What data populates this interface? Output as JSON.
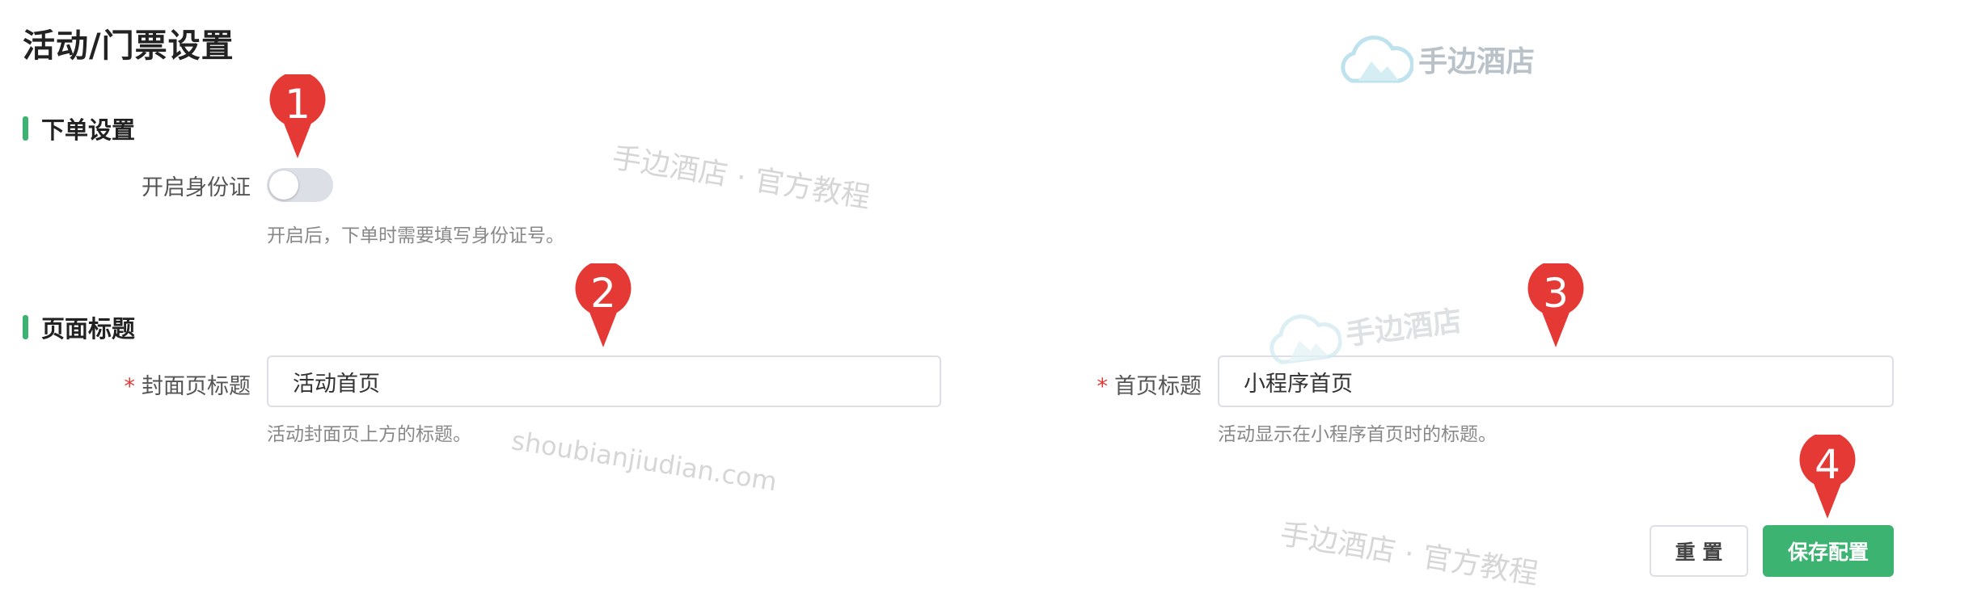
{
  "page": {
    "title": "活动/门票设置"
  },
  "order_section": {
    "heading": "下单设置",
    "id_verify": {
      "label": "开启身份证",
      "enabled": false,
      "hint": "开启后，下单时需要填写身份证号。"
    }
  },
  "title_section": {
    "heading": "页面标题",
    "cover_title": {
      "required_mark": "*",
      "label": "封面页标题",
      "value": "活动首页",
      "hint": "活动封面页上方的标题。"
    },
    "home_title": {
      "required_mark": "*",
      "label": "首页标题",
      "value": "小程序首页",
      "hint": "活动显示在小程序首页时的标题。"
    }
  },
  "actions": {
    "reset_label": "重 置",
    "save_label": "保存配置"
  },
  "markers": [
    "1",
    "2",
    "3",
    "4"
  ],
  "watermarks": {
    "brand": "手边酒店",
    "tutorial": "手边酒店 · 官方教程",
    "domain": "shoubianjiudian.com"
  },
  "colors": {
    "accent": "#3cb371",
    "marker": "#e53935",
    "required": "#e53935"
  }
}
